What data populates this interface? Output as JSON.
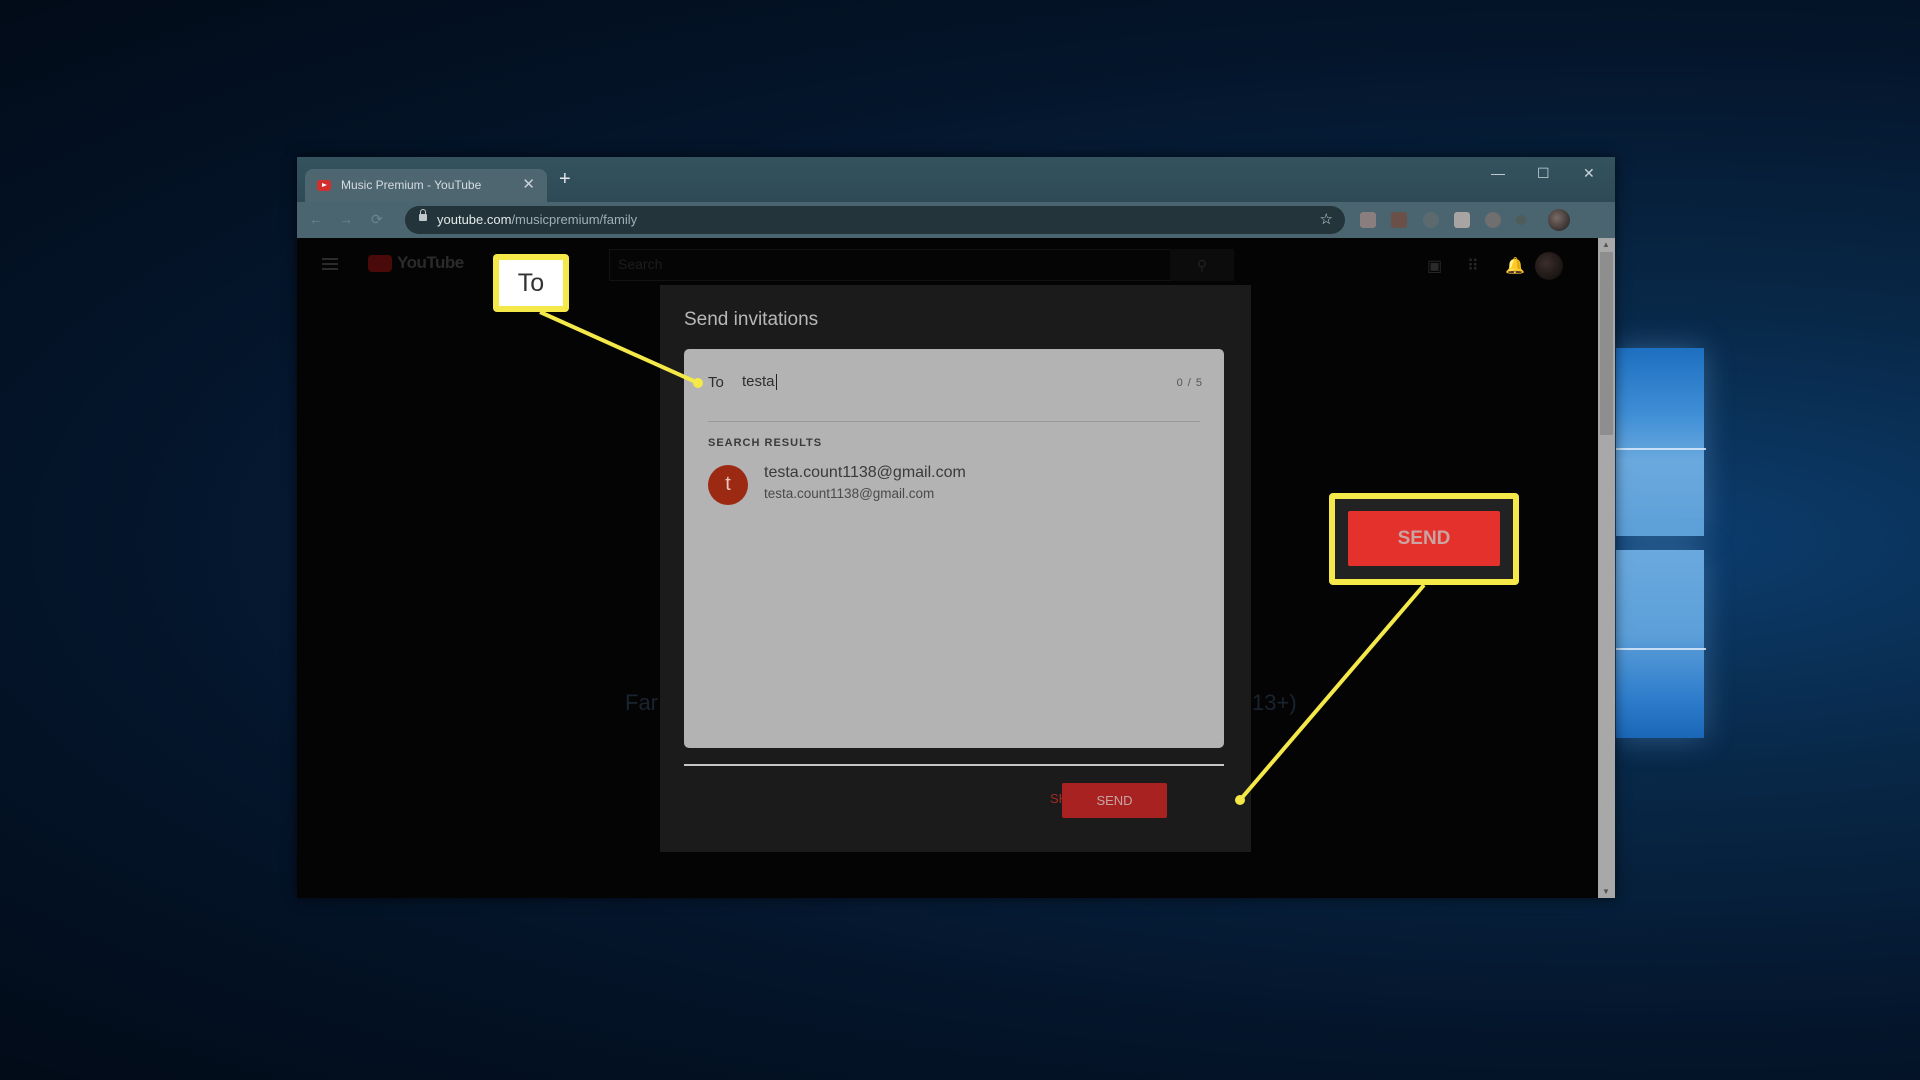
{
  "browser": {
    "tab_title": "Music Premium - YouTube",
    "tab_close": "✕",
    "new_tab": "+",
    "window_controls": {
      "minimize": "—",
      "maximize": "☐",
      "close": "✕"
    },
    "nav": {
      "back": "←",
      "forward": "→",
      "reload": "⟳"
    },
    "url_domain": "youtube.com",
    "url_path": "/musicpremium/family",
    "bookmark_star": "☆"
  },
  "youtube": {
    "logo_text": "YouTube",
    "search_placeholder": "Search",
    "search_icon": "⚲",
    "icons": {
      "create": "▣",
      "apps": "⠿",
      "notifications": "🔔"
    },
    "background_text_left": "Far",
    "background_text_right": "13+)"
  },
  "dialog": {
    "title": "Send invitations",
    "to_label": "To",
    "to_value": "testa",
    "counter": "0 / 5",
    "search_results_label": "SEARCH RESULTS",
    "results": [
      {
        "initial": "t",
        "name": "testa.count1138@gmail.com",
        "email": "testa.count1138@gmail.com",
        "avatar_color": "#9c2a12"
      }
    ],
    "skip_label": "SKIP",
    "send_label": "SEND"
  },
  "annotations": {
    "to_callout": "To",
    "send_callout": "SEND",
    "highlight_color": "#f5e94a"
  }
}
